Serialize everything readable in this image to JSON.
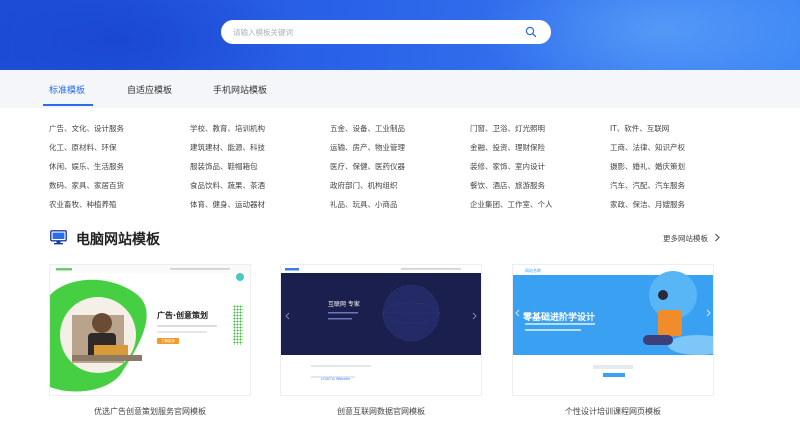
{
  "search": {
    "placeholder": "请输入模板关键词"
  },
  "tabs": [
    {
      "label": "标准模板",
      "active": true
    },
    {
      "label": "自适应模板",
      "active": false
    },
    {
      "label": "手机网站模板",
      "active": false
    }
  ],
  "categories": [
    [
      "广告、文化、设计服务",
      "学校、教育、培训机构",
      "五金、设备、工业制品",
      "门窗、卫浴、灯光照明",
      "IT、软件、互联网"
    ],
    [
      "化工、原材料、环保",
      "建筑建材、能源、科技",
      "运输、房产、物业管理",
      "金融、投资、理财保险",
      "工商、法律、知识产权"
    ],
    [
      "休闲、娱乐、生活服务",
      "服装饰品、鞋帽箱包",
      "医疗、保健、医药仪器",
      "装修、家饰、室内设计",
      "摄影、婚礼、婚庆策划"
    ],
    [
      "数码、家具、家居百货",
      "食品饮料、蔬果、茶酒",
      "政府部门、机构组织",
      "餐饮、酒店、旅游服务",
      "汽车、汽配、汽车服务"
    ],
    [
      "农业畜牧、种植养殖",
      "体育、健身、运动器材",
      "礼品、玩具、小商品",
      "企业集团、工作室、个人",
      "家政、保洁、月嫂服务"
    ]
  ],
  "section": {
    "title": "电脑网站模板",
    "more_label": "更多网站模板"
  },
  "templates": [
    {
      "name": "优选广告创意策划服务官网模板",
      "headline": "广告·创意策划",
      "button": "了解更多"
    },
    {
      "name": "创意互联网数据官网模板",
      "headline": "互联网 专家",
      "sub": "LOGO & Website"
    },
    {
      "name": "个性设计培训课程网页模板",
      "headline": "零基础进阶学设计",
      "logo": "网站名称"
    }
  ],
  "colors": {
    "accent": "#2a6cf0",
    "hero": "#2a63e8",
    "card1_green": "#3fce3f",
    "card2_navy": "#1a1f4d",
    "card3_sky": "#3a9bf0"
  },
  "icons": {
    "search": "search-icon",
    "monitor": "monitor-icon",
    "more": "chevron-right-icon"
  }
}
